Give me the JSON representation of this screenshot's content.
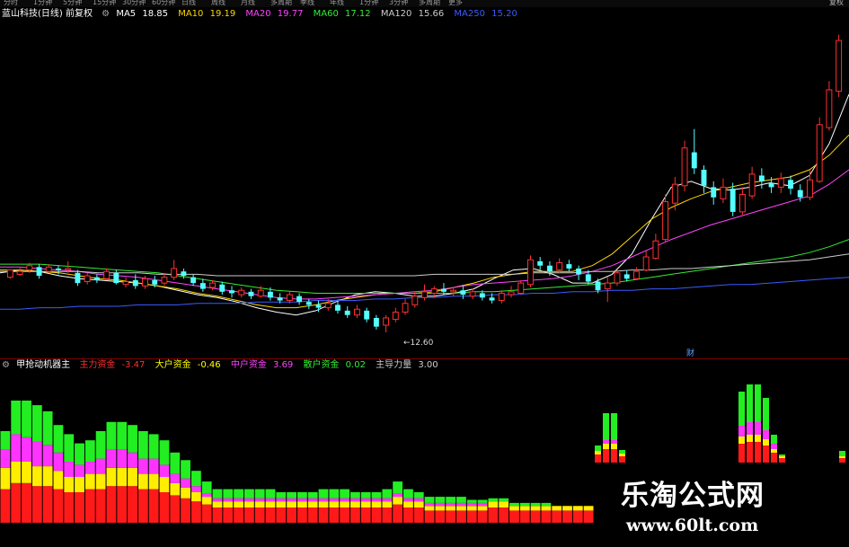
{
  "toolbar": {
    "periods": [
      "分时",
      "1分钟",
      "5分钟",
      "15分钟",
      "30分钟",
      "60分钟",
      "日线",
      "周线",
      "月线",
      "多周期",
      "季线",
      "年线",
      "1分钟",
      "3分钟",
      "多周期",
      "更多"
    ],
    "right_label": "复权"
  },
  "main_legend": {
    "title": "蓝山科技(日线) 前复权",
    "ma5": {
      "label": "MA5",
      "value": "18.85",
      "color": "#ffffff"
    },
    "ma10": {
      "label": "MA10",
      "value": "19.19",
      "color": "#ffd700"
    },
    "ma20": {
      "label": "MA20",
      "value": "19.77",
      "color": "#ff44ff"
    },
    "ma60": {
      "label": "MA60",
      "value": "17.12",
      "color": "#33ee33"
    },
    "ma120": {
      "label": "MA120",
      "value": "15.66",
      "color": "#cccccc"
    },
    "ma250": {
      "label": "MA250",
      "value": "15.20",
      "color": "#3a5bff"
    }
  },
  "indicator_legend": {
    "title": "甲抢动机器主",
    "items": [
      {
        "label": "主力资金",
        "value": "-3.47",
        "color": "#ff3030"
      },
      {
        "label": "大户资金",
        "value": "-0.46",
        "color": "#ffff00"
      },
      {
        "label": "中户资金",
        "value": "3.69",
        "color": "#ff44ff"
      },
      {
        "label": "散户资金",
        "value": "0.02",
        "color": "#33ee33"
      },
      {
        "label": "主导力量",
        "value": "3.00",
        "color": "#cccccc"
      }
    ]
  },
  "annotations": {
    "low_price": "12.60",
    "mark": "财"
  },
  "watermark": {
    "title": "乐淘公式网",
    "url": "www.60lt.com"
  },
  "colors": {
    "up": "#ff3030",
    "down": "#54ffff",
    "divider": "#7a0000"
  },
  "price_data": {
    "y_range": [
      11,
      34
    ],
    "candles": [
      [
        16.4,
        16.9,
        16.8,
        16.3
      ],
      [
        16.6,
        16.8,
        17.1,
        16.5
      ],
      [
        16.9,
        17.2,
        17.4,
        16.7
      ],
      [
        17.1,
        16.5,
        17.3,
        16.3
      ],
      [
        16.8,
        17.1,
        17.3,
        16.7
      ],
      [
        17.0,
        16.9,
        17.2,
        16.6
      ],
      [
        16.9,
        17.0,
        17.5,
        16.7
      ],
      [
        16.7,
        16.0,
        16.9,
        15.8
      ],
      [
        16.1,
        16.5,
        16.7,
        15.9
      ],
      [
        16.4,
        16.2,
        16.6,
        16.0
      ],
      [
        16.3,
        16.8,
        17.0,
        16.2
      ],
      [
        16.7,
        16.0,
        16.9,
        15.9
      ],
      [
        15.9,
        16.1,
        16.4,
        15.7
      ],
      [
        16.2,
        15.8,
        16.6,
        15.6
      ],
      [
        15.8,
        16.3,
        16.5,
        15.6
      ],
      [
        16.2,
        15.9,
        16.5,
        15.7
      ],
      [
        16.0,
        16.4,
        16.7,
        15.8
      ],
      [
        16.4,
        17.0,
        17.6,
        16.2
      ],
      [
        16.8,
        16.5,
        17.0,
        16.3
      ],
      [
        16.4,
        16.0,
        16.6,
        15.8
      ],
      [
        16.0,
        15.6,
        16.3,
        15.4
      ],
      [
        15.7,
        16.0,
        16.2,
        15.5
      ],
      [
        15.9,
        15.4,
        16.1,
        15.2
      ],
      [
        15.5,
        15.3,
        15.8,
        15.0
      ],
      [
        15.2,
        15.5,
        15.7,
        15.0
      ],
      [
        15.4,
        15.1,
        15.6,
        14.9
      ],
      [
        15.1,
        15.5,
        15.8,
        15.0
      ],
      [
        15.4,
        15.0,
        15.7,
        14.8
      ],
      [
        15.0,
        14.8,
        15.3,
        14.6
      ],
      [
        14.8,
        15.2,
        15.4,
        14.6
      ],
      [
        15.1,
        14.7,
        15.3,
        14.5
      ],
      [
        14.7,
        14.5,
        14.9,
        14.2
      ],
      [
        14.5,
        14.3,
        14.8,
        14.0
      ],
      [
        14.3,
        14.6,
        14.9,
        14.1
      ],
      [
        14.5,
        14.1,
        14.7,
        13.9
      ],
      [
        14.1,
        13.8,
        14.4,
        13.6
      ],
      [
        13.8,
        14.2,
        14.5,
        13.6
      ],
      [
        14.1,
        13.5,
        14.3,
        13.3
      ],
      [
        13.6,
        13.0,
        13.8,
        12.8
      ],
      [
        13.1,
        13.6,
        13.8,
        12.6
      ],
      [
        13.5,
        14.0,
        14.3,
        13.3
      ],
      [
        14.0,
        14.6,
        14.9,
        13.8
      ],
      [
        14.5,
        15.1,
        15.4,
        14.3
      ],
      [
        15.0,
        15.4,
        15.9,
        14.8
      ],
      [
        15.3,
        15.6,
        15.8,
        15.0
      ],
      [
        15.6,
        15.4,
        16.0,
        15.2
      ],
      [
        15.4,
        15.5,
        15.7,
        15.1
      ],
      [
        15.5,
        15.2,
        15.8,
        14.9
      ],
      [
        15.1,
        15.4,
        15.6,
        14.9
      ],
      [
        15.3,
        15.0,
        15.5,
        14.8
      ],
      [
        15.0,
        14.8,
        15.3,
        14.6
      ],
      [
        14.8,
        15.3,
        15.5,
        14.6
      ],
      [
        15.2,
        15.4,
        15.8,
        15.0
      ],
      [
        15.3,
        16.0,
        16.2,
        15.2
      ],
      [
        15.9,
        17.6,
        17.9,
        15.7
      ],
      [
        17.5,
        17.2,
        17.8,
        16.9
      ],
      [
        17.2,
        16.8,
        17.5,
        16.5
      ],
      [
        16.9,
        17.4,
        17.7,
        16.7
      ],
      [
        17.3,
        17.0,
        17.6,
        16.8
      ],
      [
        17.0,
        16.6,
        17.2,
        16.2
      ],
      [
        16.6,
        16.1,
        16.9,
        15.9
      ],
      [
        16.1,
        15.5,
        16.3,
        15.3
      ],
      [
        15.6,
        16.0,
        16.4,
        14.7
      ],
      [
        16.0,
        16.7,
        16.9,
        15.8
      ],
      [
        16.6,
        16.3,
        16.9,
        16.1
      ],
      [
        16.3,
        16.8,
        17.1,
        16.2
      ],
      [
        16.9,
        17.8,
        18.2,
        16.8
      ],
      [
        17.7,
        18.9,
        19.4,
        17.6
      ],
      [
        19.0,
        21.6,
        22.1,
        18.8
      ],
      [
        21.5,
        22.8,
        23.3,
        21.0
      ],
      [
        22.7,
        25.3,
        25.8,
        22.3
      ],
      [
        25.0,
        23.9,
        26.6,
        23.5
      ],
      [
        23.8,
        22.7,
        24.1,
        22.2
      ],
      [
        22.6,
        21.9,
        23.0,
        21.4
      ],
      [
        21.8,
        22.6,
        23.2,
        21.5
      ],
      [
        22.5,
        20.9,
        22.9,
        20.6
      ],
      [
        20.9,
        22.1,
        22.6,
        20.7
      ],
      [
        22.0,
        23.5,
        24.0,
        21.8
      ],
      [
        23.4,
        23.0,
        23.9,
        22.5
      ],
      [
        22.9,
        22.6,
        23.3,
        22.2
      ],
      [
        22.6,
        23.2,
        23.6,
        22.2
      ],
      [
        23.1,
        22.5,
        23.4,
        22.1
      ],
      [
        22.4,
        21.9,
        22.8,
        21.6
      ],
      [
        21.9,
        23.1,
        23.8,
        21.7
      ],
      [
        23.0,
        26.9,
        27.4,
        22.9
      ],
      [
        26.7,
        29.3,
        29.9,
        26.5
      ],
      [
        29.2,
        32.7,
        33.1,
        28.8
      ]
    ],
    "moving_averages": {
      "ma5": [
        16.7,
        16.9,
        16.8,
        16.5,
        16.3,
        16.2,
        16.1,
        16.0,
        15.8,
        15.5,
        15.2,
        15.0,
        14.7,
        14.3,
        14.0,
        13.8,
        14.1,
        14.7,
        15.2,
        15.4,
        15.3,
        15.1,
        15.1,
        15.3,
        15.6,
        16.3,
        16.9,
        17.0,
        16.6,
        16.0,
        16.0,
        16.6,
        18.0,
        20.4,
        22.6,
        23.0,
        22.5,
        22.4,
        22.6,
        22.9,
        22.7,
        23.4,
        25.6,
        29.0
      ],
      "ma10": [
        16.9,
        16.9,
        16.8,
        16.7,
        16.5,
        16.3,
        16.2,
        16.0,
        15.8,
        15.6,
        15.3,
        15.1,
        14.8,
        14.5,
        14.3,
        14.3,
        14.5,
        14.8,
        15.0,
        15.2,
        15.3,
        15.3,
        15.4,
        15.7,
        16.0,
        16.4,
        16.6,
        16.8,
        16.8,
        16.8,
        17.2,
        18.0,
        19.2,
        20.4,
        21.2,
        21.8,
        22.3,
        22.6,
        22.9,
        23.1,
        23.3,
        23.8,
        24.8,
        26.2
      ],
      "ma20": [
        17.1,
        17.1,
        17.0,
        16.9,
        16.8,
        16.6,
        16.5,
        16.4,
        16.2,
        16.0,
        15.8,
        15.6,
        15.4,
        15.2,
        15.0,
        14.9,
        14.9,
        15.0,
        15.1,
        15.2,
        15.3,
        15.4,
        15.5,
        15.7,
        15.9,
        16.0,
        16.1,
        16.2,
        16.3,
        16.5,
        16.8,
        17.2,
        17.8,
        18.4,
        19.0,
        19.5,
        20.0,
        20.4,
        20.8,
        21.2,
        21.6,
        22.0,
        22.8,
        23.8
      ],
      "ma60": [
        17.3,
        17.3,
        17.3,
        17.2,
        17.1,
        17.0,
        16.9,
        16.8,
        16.7,
        16.5,
        16.3,
        16.1,
        15.9,
        15.7,
        15.5,
        15.4,
        15.3,
        15.3,
        15.3,
        15.3,
        15.3,
        15.3,
        15.3,
        15.3,
        15.4,
        15.4,
        15.5,
        15.6,
        15.7,
        15.8,
        15.9,
        16.0,
        16.2,
        16.4,
        16.6,
        16.8,
        17.0,
        17.2,
        17.4,
        17.6,
        17.8,
        18.1,
        18.5,
        19.0
      ],
      "ma120": [
        16.8,
        16.8,
        16.8,
        16.8,
        16.8,
        16.7,
        16.7,
        16.7,
        16.6,
        16.6,
        16.6,
        16.5,
        16.5,
        16.5,
        16.5,
        16.5,
        16.5,
        16.5,
        16.5,
        16.5,
        16.5,
        16.5,
        16.6,
        16.6,
        16.6,
        16.6,
        16.6,
        16.7,
        16.7,
        16.7,
        16.8,
        16.8,
        16.9,
        16.9,
        17.0,
        17.0,
        17.1,
        17.2,
        17.3,
        17.4,
        17.5,
        17.6,
        17.8,
        18.0
      ],
      "ma250": [
        14.2,
        14.2,
        14.3,
        14.3,
        14.4,
        14.4,
        14.4,
        14.5,
        14.5,
        14.5,
        14.6,
        14.6,
        14.6,
        14.7,
        14.7,
        14.7,
        14.8,
        14.8,
        14.8,
        14.9,
        14.9,
        15.0,
        15.0,
        15.1,
        15.1,
        15.2,
        15.2,
        15.3,
        15.3,
        15.4,
        15.4,
        15.5,
        15.5,
        15.6,
        15.6,
        15.7,
        15.8,
        15.9,
        15.9,
        16.0,
        16.1,
        16.2,
        16.3,
        16.4
      ]
    }
  },
  "indicator_data": {
    "y_max": 100,
    "bars": [
      [
        22,
        14,
        12,
        12
      ],
      [
        26,
        14,
        18,
        22
      ],
      [
        26,
        14,
        16,
        24
      ],
      [
        24,
        13,
        16,
        24
      ],
      [
        24,
        13,
        14,
        22
      ],
      [
        22,
        12,
        12,
        18
      ],
      [
        20,
        10,
        10,
        18
      ],
      [
        20,
        10,
        8,
        14
      ],
      [
        22,
        10,
        8,
        14
      ],
      [
        22,
        10,
        10,
        18
      ],
      [
        24,
        12,
        12,
        18
      ],
      [
        24,
        12,
        12,
        18
      ],
      [
        24,
        12,
        10,
        18
      ],
      [
        22,
        10,
        10,
        18
      ],
      [
        22,
        10,
        10,
        16
      ],
      [
        20,
        10,
        8,
        16
      ],
      [
        18,
        8,
        6,
        14
      ],
      [
        16,
        7,
        6,
        12
      ],
      [
        14,
        6,
        4,
        10
      ],
      [
        12,
        5,
        2,
        8
      ],
      [
        10,
        4,
        2,
        6
      ],
      [
        10,
        4,
        2,
        6
      ],
      [
        10,
        4,
        2,
        6
      ],
      [
        10,
        4,
        2,
        6
      ],
      [
        10,
        4,
        2,
        6
      ],
      [
        10,
        4,
        2,
        6
      ],
      [
        10,
        4,
        2,
        4
      ],
      [
        10,
        4,
        2,
        4
      ],
      [
        10,
        4,
        2,
        4
      ],
      [
        10,
        4,
        2,
        4
      ],
      [
        10,
        4,
        2,
        6
      ],
      [
        10,
        4,
        2,
        6
      ],
      [
        10,
        4,
        2,
        6
      ],
      [
        10,
        4,
        2,
        4
      ],
      [
        10,
        4,
        2,
        4
      ],
      [
        10,
        4,
        2,
        4
      ],
      [
        10,
        4,
        2,
        6
      ],
      [
        12,
        5,
        2,
        8
      ],
      [
        10,
        4,
        2,
        6
      ],
      [
        10,
        4,
        2,
        4
      ],
      [
        8,
        3,
        2,
        4
      ],
      [
        8,
        3,
        2,
        4
      ],
      [
        8,
        3,
        2,
        4
      ],
      [
        8,
        3,
        2,
        4
      ],
      [
        8,
        3,
        2,
        2
      ],
      [
        8,
        3,
        2,
        2
      ],
      [
        10,
        4,
        0,
        2
      ],
      [
        10,
        4,
        0,
        2
      ],
      [
        8,
        3,
        0,
        2
      ],
      [
        8,
        3,
        0,
        2
      ],
      [
        8,
        3,
        0,
        2
      ],
      [
        8,
        3,
        0,
        2
      ],
      [
        8,
        3,
        0,
        0
      ],
      [
        8,
        3,
        0,
        0
      ],
      [
        8,
        3,
        0,
        0
      ],
      [
        8,
        3,
        0,
        0
      ]
    ]
  }
}
